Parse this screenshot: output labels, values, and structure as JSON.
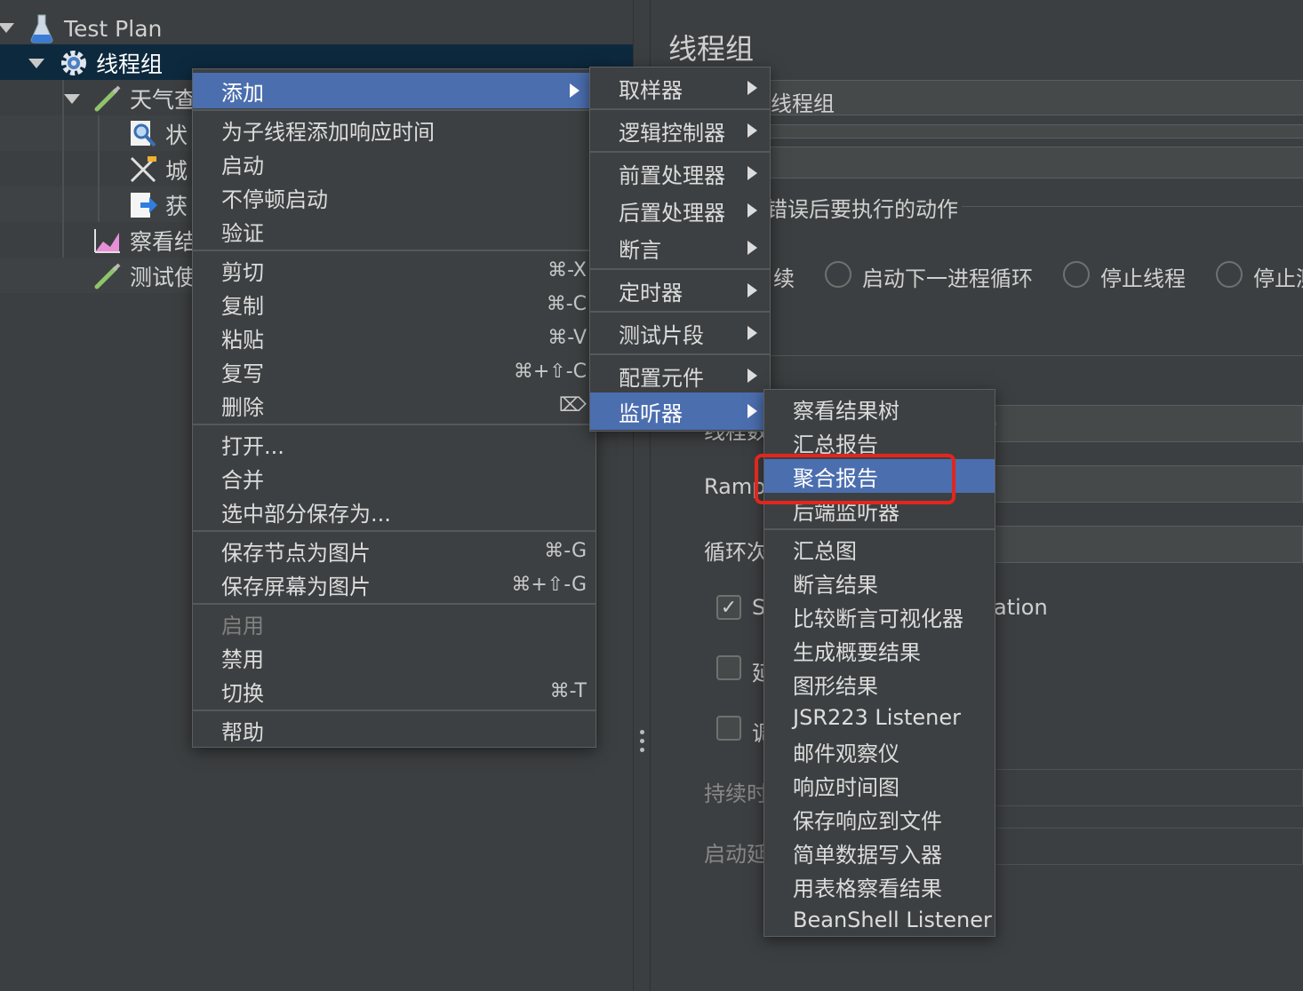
{
  "tree": {
    "items": [
      {
        "label": "Test Plan",
        "icon": "flask-icon"
      },
      {
        "label": "线程组",
        "icon": "gear-icon"
      },
      {
        "label": "天气查",
        "icon": "pipette-icon"
      },
      {
        "label": "状",
        "icon": "magnifier-icon"
      },
      {
        "label": "城",
        "icon": "scissors-icon"
      },
      {
        "label": "获",
        "icon": "extract-arrow-icon"
      },
      {
        "label": "察看结",
        "icon": "graph-icon"
      },
      {
        "label": "测试使",
        "icon": "pipette-icon"
      }
    ]
  },
  "right_panel": {
    "title": "线程组",
    "name_field_value": "线程组",
    "error_action_label": "错误后要执行的动作",
    "radio_labels": [
      "续",
      "启动下一进程循环",
      "停止线程",
      "停止测"
    ],
    "ramp_label": "Ramp",
    "loop_label": "循环次",
    "partial_label": "线程数",
    "check_labels": [
      "S",
      "延",
      "调"
    ],
    "ation_label": "ation",
    "duration_label": "持续时",
    "startup_label": "启动延",
    "paren_label": ")"
  },
  "context_menu": {
    "items": [
      {
        "label": "添加",
        "shortcut": ""
      },
      {
        "label": "为子线程添加响应时间",
        "shortcut": ""
      },
      {
        "label": "启动",
        "shortcut": ""
      },
      {
        "label": "不停顿启动",
        "shortcut": ""
      },
      {
        "label": "验证",
        "shortcut": ""
      },
      {
        "label": "剪切",
        "shortcut": "⌘-X"
      },
      {
        "label": "复制",
        "shortcut": "⌘-C"
      },
      {
        "label": "粘贴",
        "shortcut": "⌘-V"
      },
      {
        "label": "复写",
        "shortcut": "⌘+⇧-C"
      },
      {
        "label": "删除",
        "shortcut": "⌦"
      },
      {
        "label": "打开...",
        "shortcut": ""
      },
      {
        "label": "合并",
        "shortcut": ""
      },
      {
        "label": "选中部分保存为...",
        "shortcut": ""
      },
      {
        "label": "保存节点为图片",
        "shortcut": "⌘-G"
      },
      {
        "label": "保存屏幕为图片",
        "shortcut": "⌘+⇧-G"
      },
      {
        "label": "启用",
        "shortcut": ""
      },
      {
        "label": "禁用",
        "shortcut": ""
      },
      {
        "label": "切换",
        "shortcut": "⌘-T"
      },
      {
        "label": "帮助",
        "shortcut": ""
      }
    ]
  },
  "add_submenu": {
    "items": [
      "取样器",
      "逻辑控制器",
      "前置处理器",
      "后置处理器",
      "断言",
      "定时器",
      "测试片段",
      "配置元件",
      "监听器"
    ]
  },
  "listener_submenu": {
    "items": [
      "察看结果树",
      "汇总报告",
      "聚合报告",
      "后端监听器",
      "汇总图",
      "断言结果",
      "比较断言可视化器",
      "生成概要结果",
      "图形结果",
      "JSR223 Listener",
      "邮件观察仪",
      "响应时间图",
      "保存响应到文件",
      "简单数据写入器",
      "用表格察看结果",
      "BeanShell Listener"
    ]
  },
  "colors": {
    "selection": "#4b6eaf",
    "highlight_border": "#e2261d",
    "background": "#3c3f41"
  }
}
